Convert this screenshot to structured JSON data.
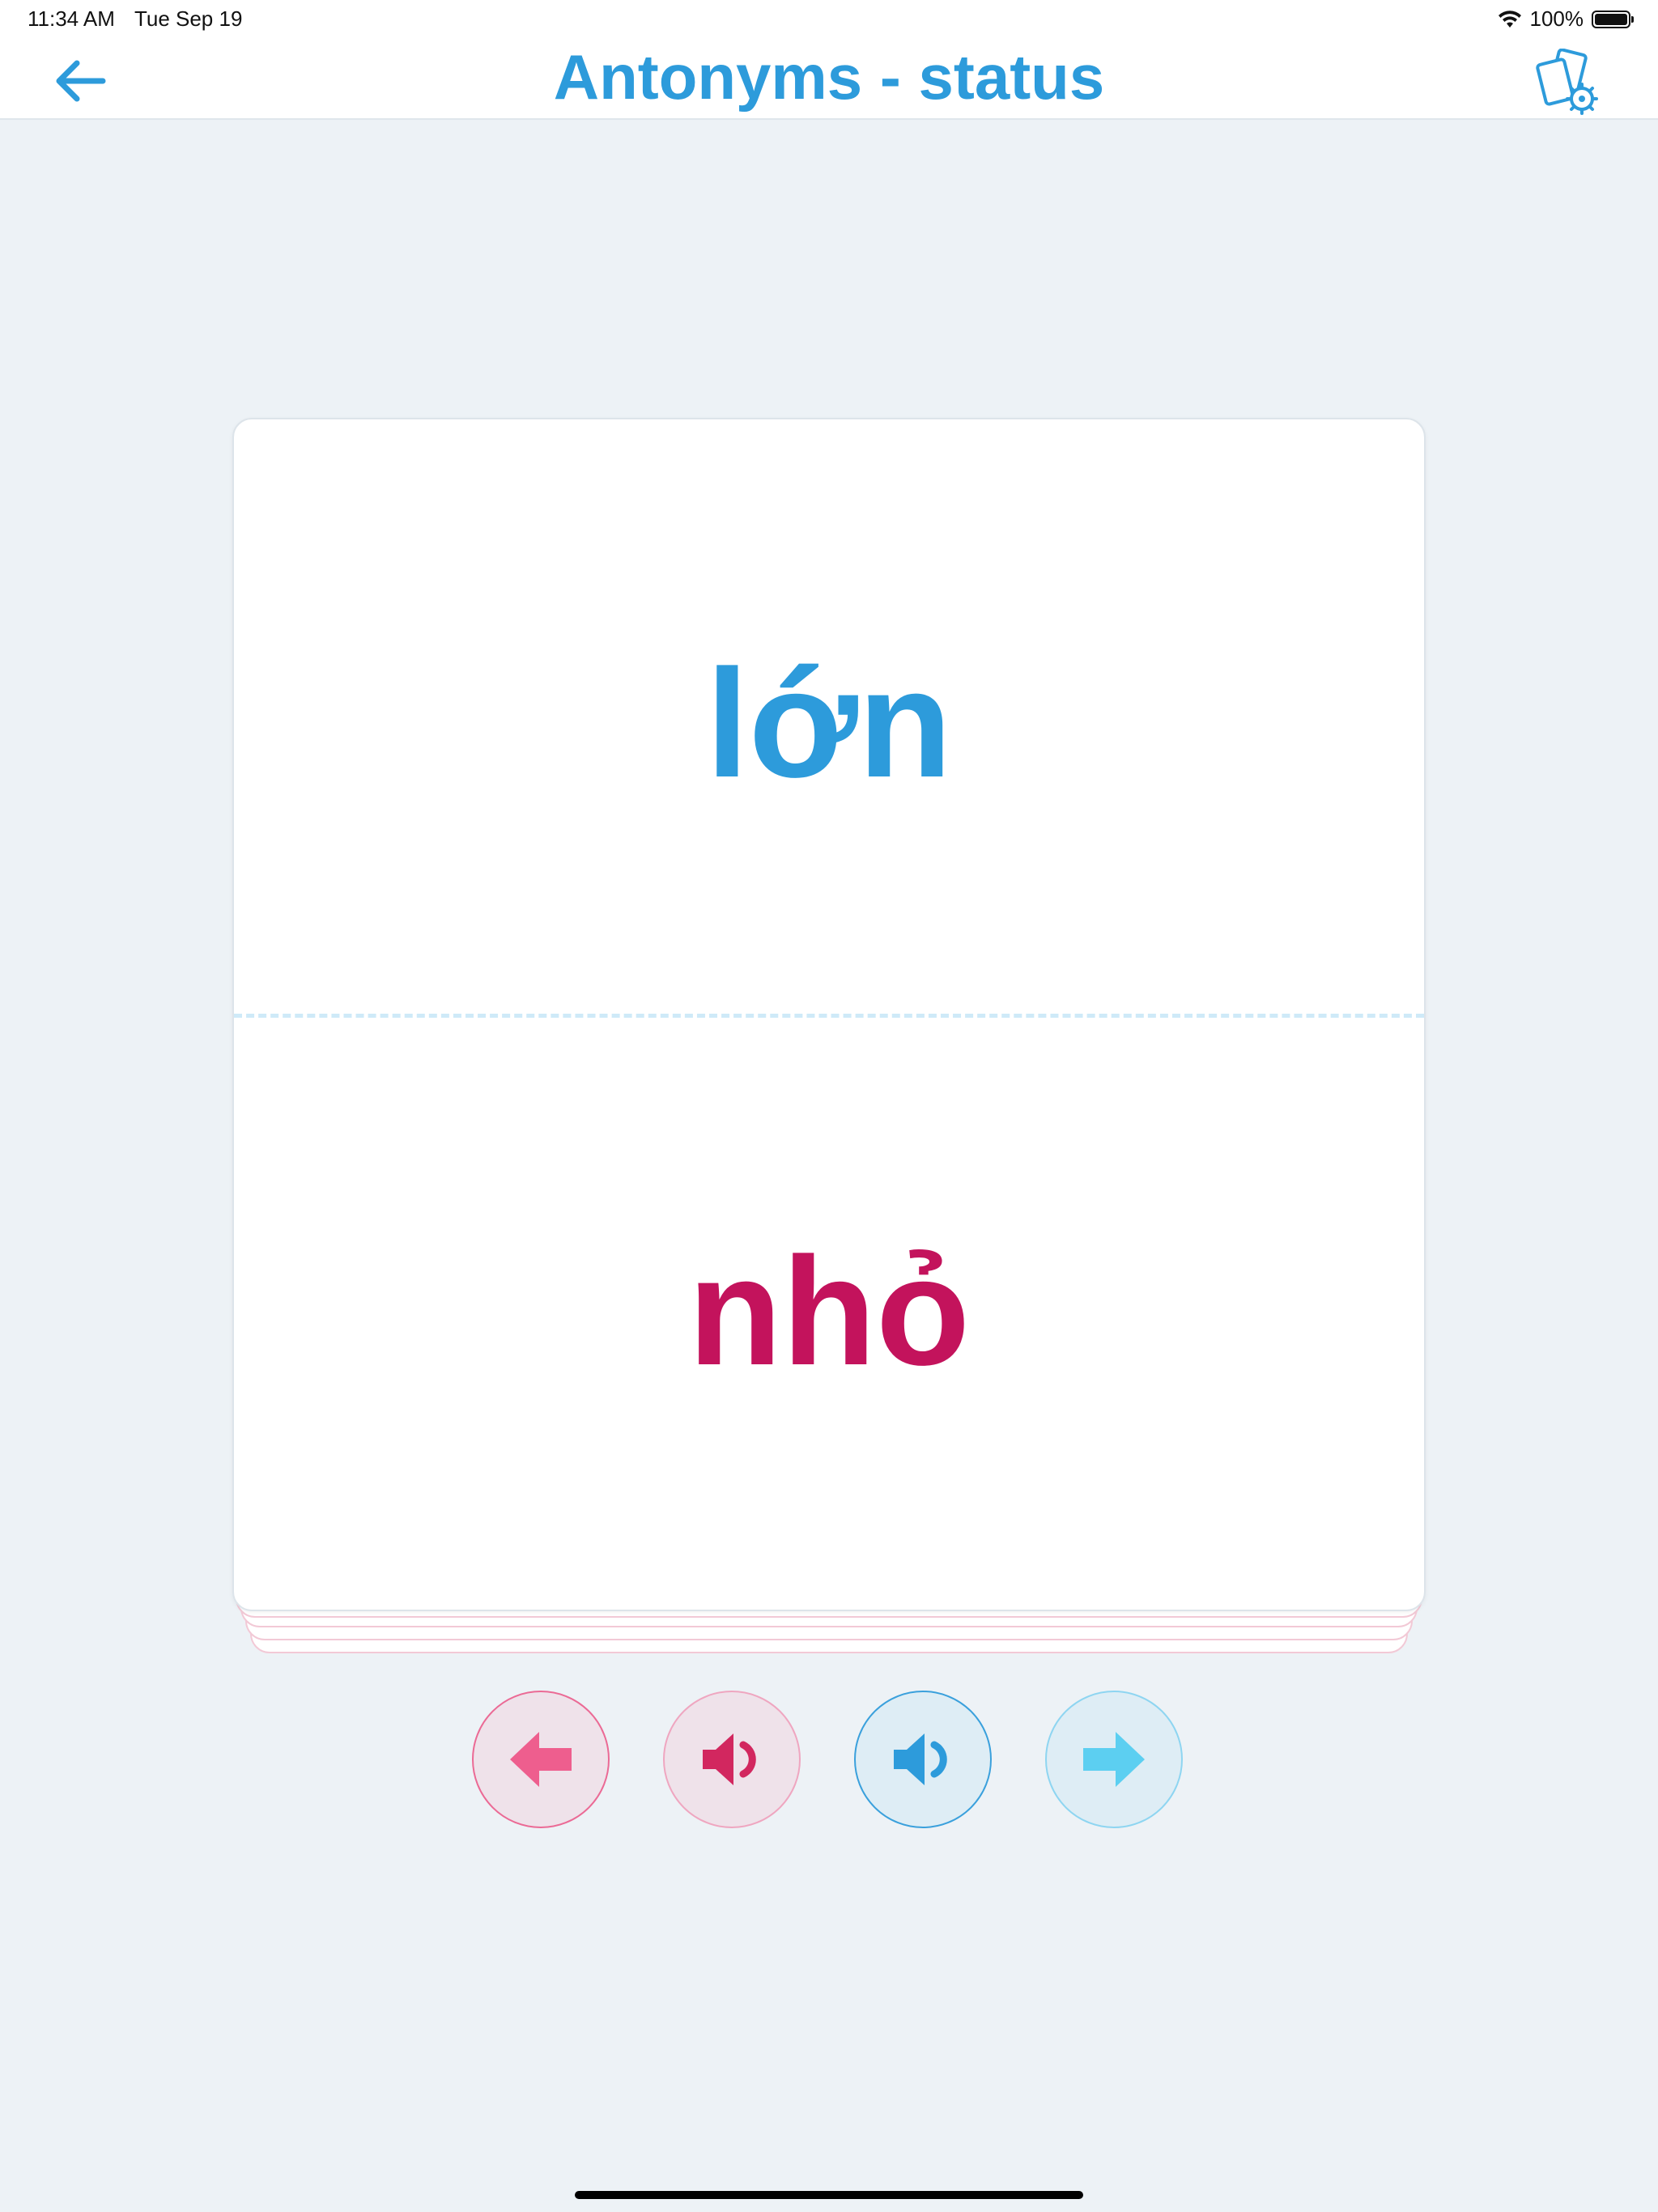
{
  "status_bar": {
    "time": "11:34 AM",
    "date": "Tue Sep 19",
    "battery": "100%"
  },
  "header": {
    "title": "Antonyms - status",
    "back_icon": "arrow-left-icon",
    "settings_icon": "cards-gear-icon"
  },
  "card": {
    "top_word": "lớn",
    "bottom_word": "nhỏ"
  },
  "controls": {
    "prev_icon": "arrow-left-icon",
    "audio_bottom_icon": "speaker-icon",
    "audio_top_icon": "speaker-icon",
    "next_icon": "arrow-right-icon"
  },
  "colors": {
    "primary_blue": "#2d9bdb",
    "accent_pink": "#c3135c",
    "background": "#edf2f6"
  }
}
